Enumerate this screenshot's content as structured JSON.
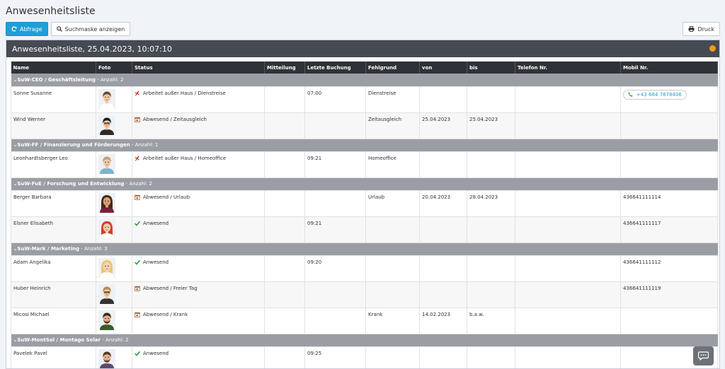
{
  "page": {
    "title": "Anwesenheitsliste"
  },
  "toolbar": {
    "query_label": "Abfrage",
    "search_label": "Suchmaske anzeigen",
    "print_label": "Druck"
  },
  "panel": {
    "title": "Anwesenheitsliste, 25.04.2023, 10:07:10"
  },
  "columns": [
    "Name",
    "Foto",
    "Status",
    "Mitteilung",
    "Letzte Buchung",
    "Fehlgrund",
    "von",
    "bis",
    "Telefon Nr.",
    "Mobil Nr."
  ],
  "groups": [
    {
      "name": "SuW-CEO / Geschäftsleitung",
      "count_label": " - Anzahl: 2"
    },
    {
      "name": "SuW-FF / Finanzierung und Förderungen",
      "count_label": " - Anzahl: 1"
    },
    {
      "name": "SuW-FuE / Forschung und Entwicklung",
      "count_label": " - Anzahl: 2"
    },
    {
      "name": "SuW-Mark / Marketing",
      "count_label": " - Anzahl: 3"
    },
    {
      "name": "SuW-MontSol / Montage Solar",
      "count_label": " - Anzahl: 2"
    }
  ],
  "rows": [
    {
      "name": "Sonne Susanne",
      "status": "Arbeitet außer Haus / Dienstreise",
      "status_icon": "plane-icon",
      "mitteilung": "",
      "letzte": "07:00",
      "fehlgrund": "Dienstreise",
      "von": "",
      "bis": "",
      "telefon": "",
      "mobil": "+43 664 7878406"
    },
    {
      "name": "Wind Werner",
      "status": "Abwesend / Zeitausgleich",
      "status_icon": "calendar-icon",
      "mitteilung": "",
      "letzte": "",
      "fehlgrund": "Zeitausgleich",
      "von": "25.04.2023",
      "bis": "25.04.2023",
      "telefon": "",
      "mobil": ""
    },
    {
      "name": "Leonhardtsberger Leo",
      "status": "Arbeitet außer Haus / Homeoffice",
      "status_icon": "plane-icon",
      "mitteilung": "",
      "letzte": "09:21",
      "fehlgrund": "Homeoffice",
      "von": "",
      "bis": "",
      "telefon": "",
      "mobil": ""
    },
    {
      "name": "Berger Barbara",
      "status": "Abwesend / Urlaub",
      "status_icon": "calendar-icon",
      "mitteilung": "",
      "letzte": "",
      "fehlgrund": "Urlaub",
      "von": "20.04.2023",
      "bis": "28.04.2023",
      "telefon": "",
      "mobil": "436641111114"
    },
    {
      "name": "Elsner Elisabeth",
      "status": "Anwesend",
      "status_icon": "check-icon",
      "mitteilung": "",
      "letzte": "09:21",
      "fehlgrund": "",
      "von": "",
      "bis": "",
      "telefon": "",
      "mobil": "436641111117"
    },
    {
      "name": "Adam Angelika",
      "status": "Anwesend",
      "status_icon": "check-icon",
      "mitteilung": "",
      "letzte": "09:20",
      "fehlgrund": "",
      "von": "",
      "bis": "",
      "telefon": "",
      "mobil": "436641111112"
    },
    {
      "name": "Huber Heinrich",
      "status": "Abwesend / Freier Tag",
      "status_icon": "calendar-icon",
      "mitteilung": "",
      "letzte": "",
      "fehlgrund": "",
      "von": "",
      "bis": "",
      "telefon": "",
      "mobil": "436641111119"
    },
    {
      "name": "Micosi Michael",
      "status": "Abwesend / Krank",
      "status_icon": "calendar-icon",
      "mitteilung": "",
      "letzte": "",
      "fehlgrund": "Krank",
      "von": "14.02.2023",
      "bis": "b.a.w.",
      "telefon": "",
      "mobil": ""
    },
    {
      "name": "Pavelek Pavel",
      "status": "Anwesend",
      "status_icon": "check-icon",
      "mitteilung": "",
      "letzte": "09:25",
      "fehlgrund": "",
      "von": "",
      "bis": "",
      "telefon": "",
      "mobil": ""
    }
  ],
  "colors": {
    "primary": "#1e9fd6",
    "header": "#464a52",
    "group": "#9a9ea4",
    "check": "#2e9e3e",
    "plane": "#c0392b",
    "badge": "#f39c12"
  }
}
